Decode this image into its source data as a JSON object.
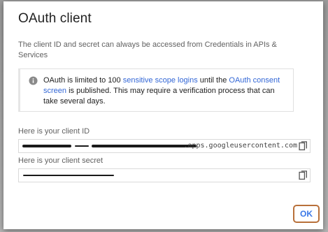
{
  "dialog": {
    "title": "OAuth client",
    "description": "The client ID and secret can always be accessed from Credentials in APIs & Services",
    "notice": {
      "icon": "info-icon",
      "text_before": "OAuth is limited to 100 ",
      "link1": "sensitive scope logins",
      "text_middle": " until the ",
      "link2": "OAuth consent screen",
      "text_after": " is published. This may require a verification process that can take several days."
    },
    "client_id": {
      "label": "Here is your client ID",
      "visible_suffix": ".apps.googleusercontent.com"
    },
    "client_secret": {
      "label": "Here is your client secret"
    },
    "ok_label": "OK"
  },
  "colors": {
    "link": "#3367d6",
    "ok_text": "#3b78e7",
    "ok_highlight_border": "#b8703a"
  }
}
